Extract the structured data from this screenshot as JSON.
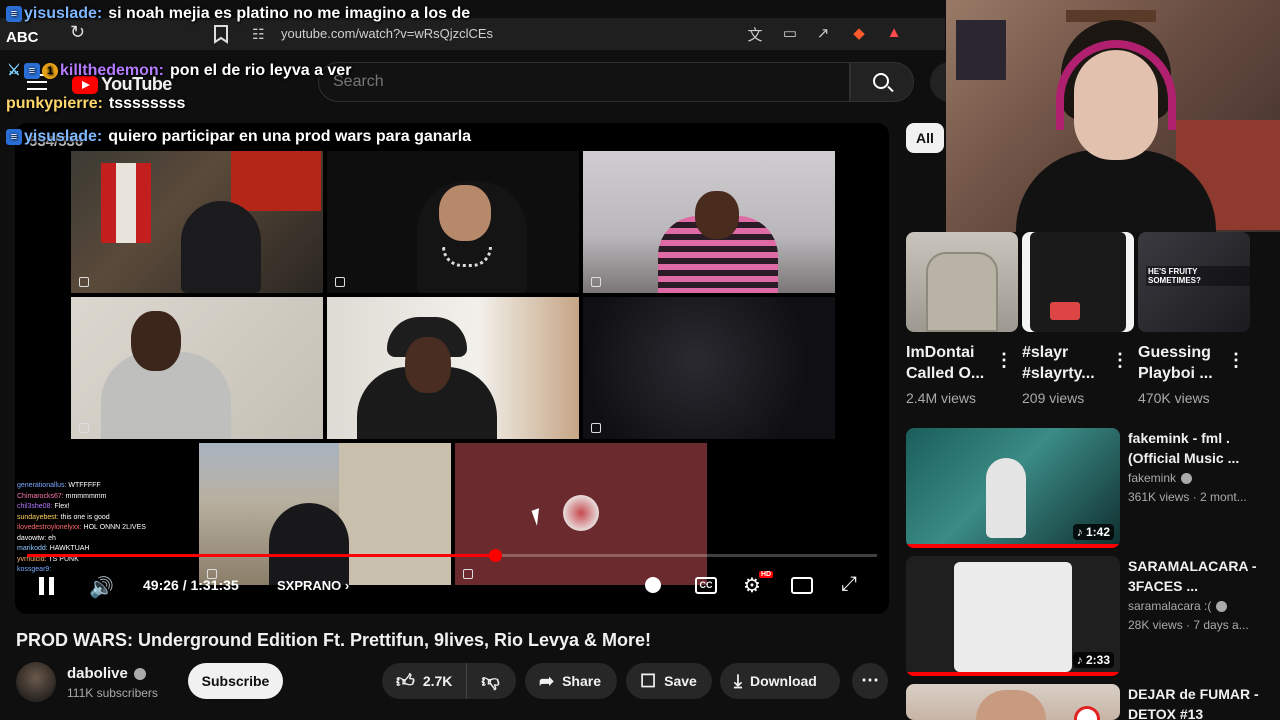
{
  "browser": {
    "left_label": "ABC",
    "url": "youtube.com/watch?v=wRsQjzclCEs"
  },
  "header": {
    "logo_text": "YouTube",
    "search_placeholder": "Search"
  },
  "chat_overlay": [
    {
      "user": "yisuslade:",
      "message": "si noah mejia es platino no me imagino a los de",
      "user_color": "#7fb8ff"
    },
    {
      "user": "killthedemon:",
      "message": "pon el de rio leyva a ver",
      "user_color": "#b47cff"
    },
    {
      "user": "punkypierre:",
      "message": "tssssssss",
      "user_color": "#ffd86b"
    },
    {
      "user": "yisuslade:",
      "message": "quiero participar en una prod wars para ganarla",
      "user_color": "#7fb8ff"
    }
  ],
  "player": {
    "counter": "534/536",
    "time": "49:26 / 1:31:35",
    "chapter": "SXPRANO",
    "progress": 0.55,
    "cc_label": "CC",
    "hd_label": "HD",
    "mini_chat": [
      {
        "user": "generationallus:",
        "msg": "WTFFFFF"
      },
      {
        "user": "Chimarocks67:",
        "msg": "mmmmmmm"
      },
      {
        "user": "chil3she08:",
        "msg": "Flex!"
      },
      {
        "user": "sundayebest:",
        "msg": "this one is good"
      },
      {
        "user": "ilovedestroylonelyxx:",
        "msg": "HOL ONNN 2LIVES"
      },
      {
        "user": "davowtw:",
        "msg": "eh"
      },
      {
        "user": "marikodd:",
        "msg": "HAWKTUAH"
      },
      {
        "user": "yvrnulcid:",
        "msg": "TS PUNK"
      },
      {
        "user": "kossgear9:",
        "msg": ""
      }
    ]
  },
  "video": {
    "title": "PROD WARS: Underground Edition Ft. Prettifun, 9lives, Rio Levya & More!",
    "channel": "dabolive",
    "subscribers": "111K subscribers",
    "subscribe_label": "Subscribe",
    "likes": "2.7K",
    "share_label": "Share",
    "save_label": "Save",
    "download_label": "Download"
  },
  "sidebar": {
    "chip_all": "All",
    "shorts": [
      {
        "title": "ImDontai Called O...",
        "views": "2.4M views"
      },
      {
        "title": "#slayr #slayrty...",
        "views": "209 views"
      },
      {
        "title": "Guessing Playboi ...",
        "views": "470K views",
        "caption": "HE'S FRUITY SOMETIMES?"
      }
    ],
    "videos": [
      {
        "title_line1": "fakemink - fml .",
        "title_line2": "(Official Music ...",
        "channel": "fakemink",
        "meta": "361K views · 2 mont...",
        "duration": "1:42"
      },
      {
        "title_line1": "SARAMALACARA -",
        "title_line2": "3FACES ...",
        "channel": "saramalacara :(",
        "meta": "28K views · 7 days a...",
        "duration": "2:33"
      },
      {
        "title_line1": "DEJAR de FUMAR -",
        "title_line2": "DETOX #13"
      }
    ]
  }
}
